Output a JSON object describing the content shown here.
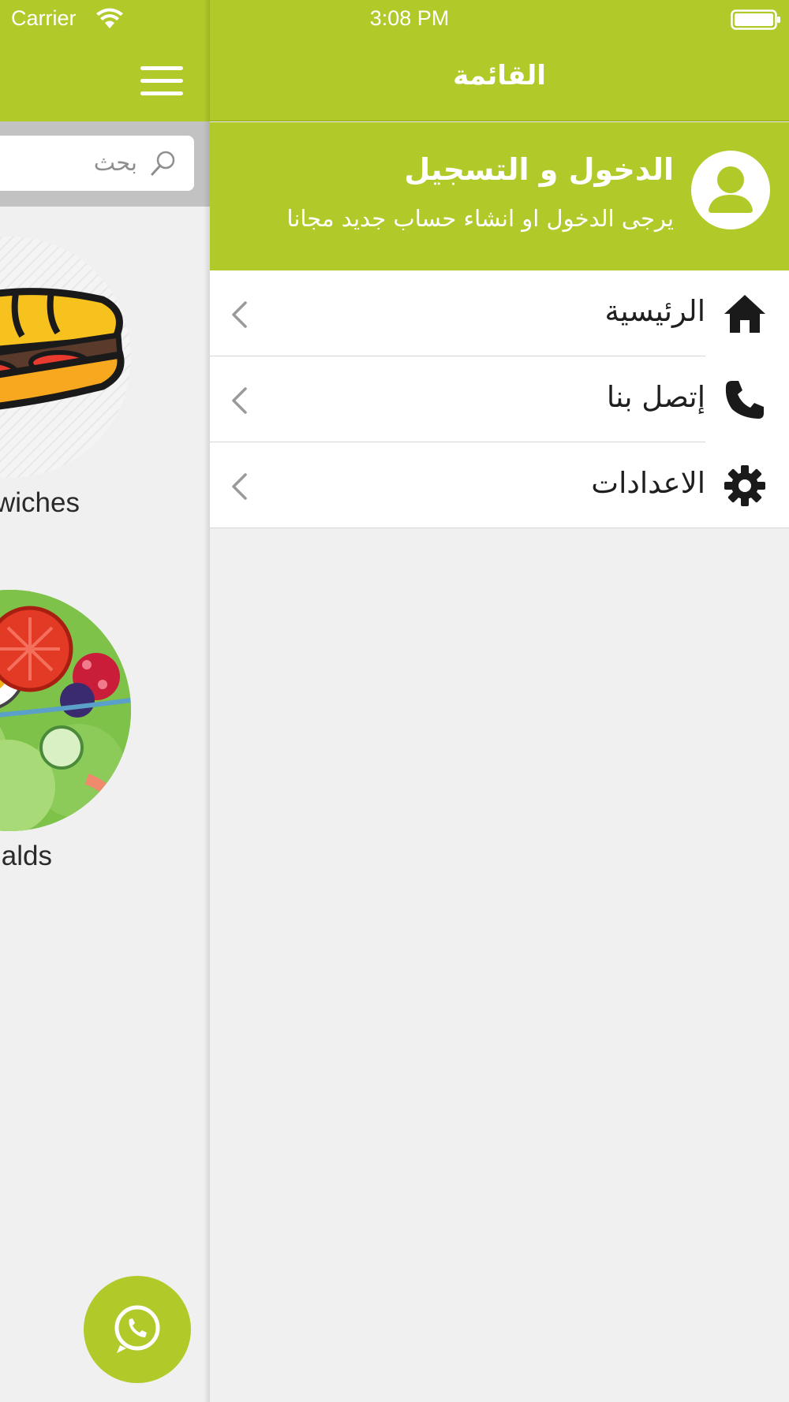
{
  "status_bar": {
    "carrier": "Carrier",
    "time": "3:08 PM"
  },
  "app": {
    "search": {
      "placeholder": "بحث"
    },
    "categories": [
      {
        "label": "wiches",
        "image": "sandwich-illustration"
      },
      {
        "label": "lalds",
        "image": "salad-illustration"
      }
    ],
    "fab": {
      "icon": "whatsapp-icon"
    }
  },
  "drawer": {
    "title": "القائمة",
    "login": {
      "title": "الدخول و التسجيل",
      "subtitle": "يرجى الدخول او انشاء حساب جديد مجانا",
      "icon": "user-avatar-icon"
    },
    "items": [
      {
        "label": "الرئيسية",
        "icon": "home-icon"
      },
      {
        "label": "إتصل بنا",
        "icon": "phone-icon"
      },
      {
        "label": "الاعدادات",
        "icon": "gear-icon"
      }
    ]
  },
  "colors": {
    "primary": "#b1ca29",
    "background": "#f0f0f0",
    "text": "#1f1f1f"
  }
}
